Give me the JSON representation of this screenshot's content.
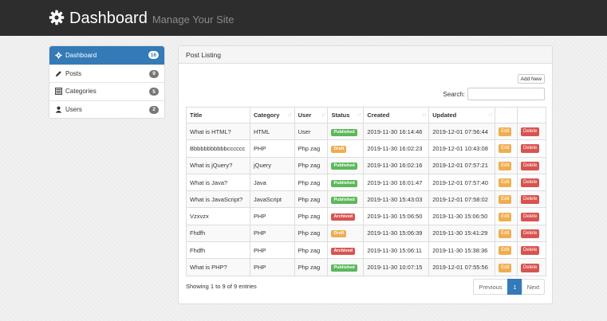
{
  "header": {
    "title": "Dashboard",
    "subtitle": "Manage Your Site",
    "icon": "gear-icon"
  },
  "sidebar": {
    "items": [
      {
        "label": "Dashboard",
        "count": "16",
        "icon": "gear-icon",
        "active": true
      },
      {
        "label": "Posts",
        "count": "9",
        "icon": "pencil-icon",
        "active": false
      },
      {
        "label": "Categories",
        "count": "5",
        "icon": "list-icon",
        "active": false
      },
      {
        "label": "Users",
        "count": "2",
        "icon": "user-icon",
        "active": false
      }
    ]
  },
  "panel": {
    "title": "Post Listing",
    "add_new_label": "Add New",
    "search_label": "Search:",
    "search_value": ""
  },
  "table": {
    "columns": [
      "Title",
      "Category",
      "User",
      "Status",
      "Created",
      "Updated",
      "",
      ""
    ],
    "rows": [
      {
        "title": "What is HTML?",
        "category": "HTML",
        "user": "User",
        "status": "Published",
        "created": "2019-11-30 16:14:46",
        "updated": "2019-12-01 07:56:44",
        "edit": "Edit",
        "delete": "Delete"
      },
      {
        "title": "Bbbbbbbbbbbcccccc",
        "category": "PHP",
        "user": "Php zag",
        "status": "Draft",
        "created": "2019-11-30 16:02:23",
        "updated": "2019-12-01 10:43:08",
        "edit": "Edit",
        "delete": "Delete"
      },
      {
        "title": "What is jQuery?",
        "category": "jQuery",
        "user": "Php zag",
        "status": "Published",
        "created": "2019-11-30 16:02:16",
        "updated": "2019-12-01 07:57:21",
        "edit": "Edit",
        "delete": "Delete"
      },
      {
        "title": "What is Java?",
        "category": "Java",
        "user": "Php zag",
        "status": "Published",
        "created": "2019-11-30 16:01:47",
        "updated": "2019-12-01 07:57:40",
        "edit": "Edit",
        "delete": "Delete"
      },
      {
        "title": "What is JavaScript?",
        "category": "JavaScript",
        "user": "Php zag",
        "status": "Published",
        "created": "2019-11-30 15:43:03",
        "updated": "2019-12-01 07:58:02",
        "edit": "Edit",
        "delete": "Delete"
      },
      {
        "title": "Vzxvzx",
        "category": "PHP",
        "user": "Php zag",
        "status": "Archived",
        "created": "2019-11-30 15:06:50",
        "updated": "2019-11-30 15:06:50",
        "edit": "Edit",
        "delete": "Delete"
      },
      {
        "title": "Fhdfh",
        "category": "PHP",
        "user": "Php zag",
        "status": "Draft",
        "created": "2019-11-30 15:06:39",
        "updated": "2019-11-30 15:41:29",
        "edit": "Edit",
        "delete": "Delete"
      },
      {
        "title": "Fhdfh",
        "category": "PHP",
        "user": "Php zag",
        "status": "Archived",
        "created": "2019-11-30 15:06:11",
        "updated": "2019-11-30 15:38:36",
        "edit": "Edit",
        "delete": "Delete"
      },
      {
        "title": "What is PHP?",
        "category": "PHP",
        "user": "Php zag",
        "status": "Published",
        "created": "2019-11-30 10:07:15",
        "updated": "2019-12-01 07:55:56",
        "edit": "Edit",
        "delete": "Delete"
      }
    ]
  },
  "status_colors": {
    "Published": "#5cb85c",
    "Draft": "#f0ad4e",
    "Archived": "#d9534f"
  },
  "footer": {
    "info": "Showing 1 to 9 of 9 entries",
    "previous": "Previous",
    "page": "1",
    "next": "Next"
  }
}
